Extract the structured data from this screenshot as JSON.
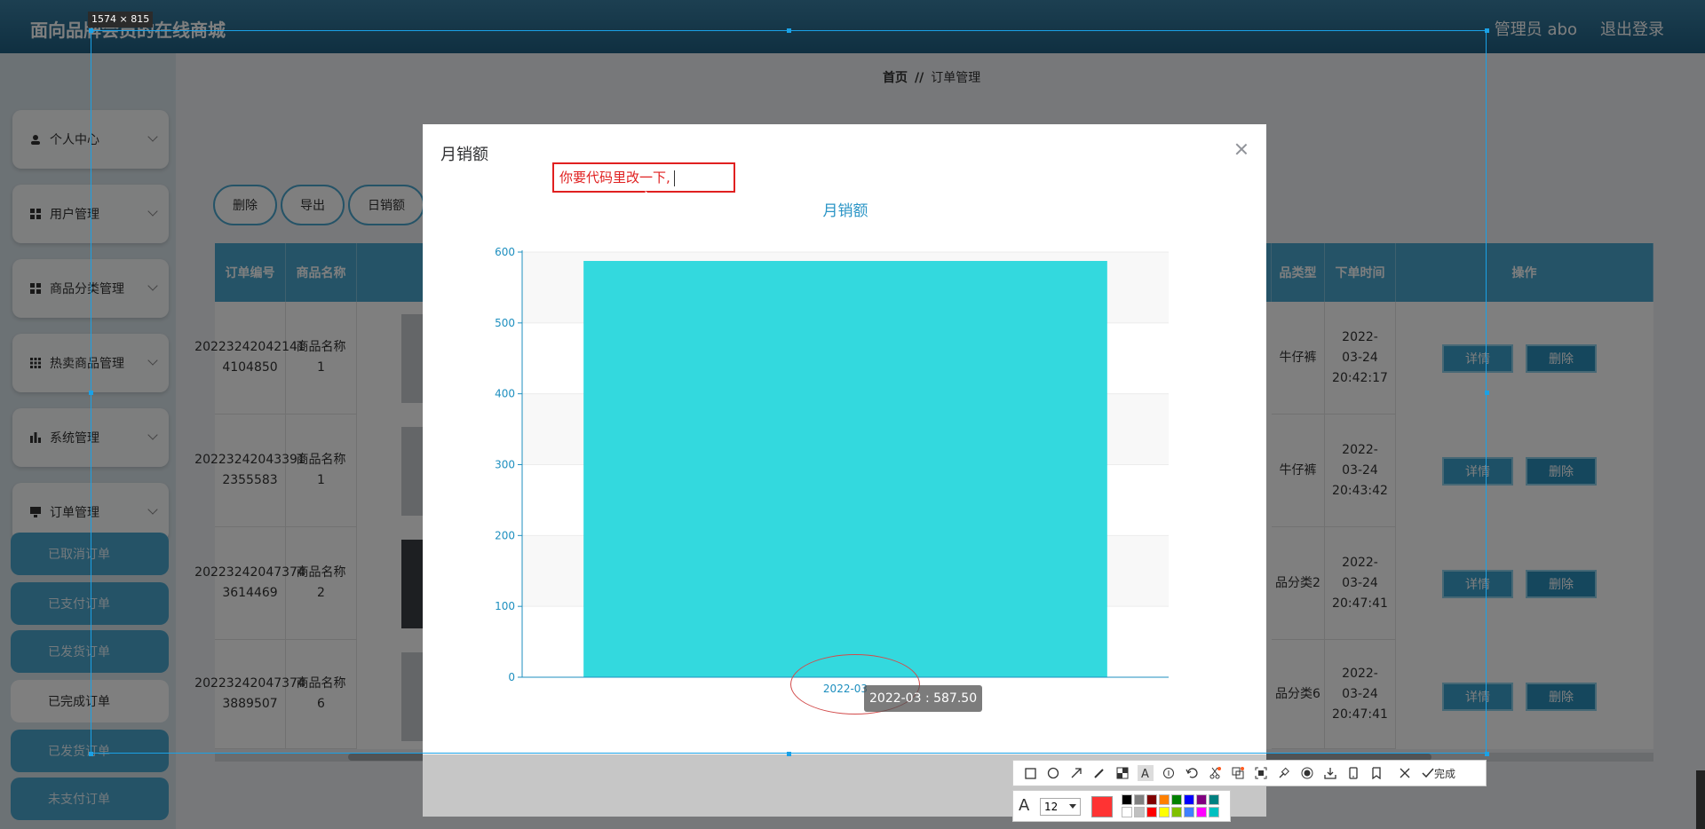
{
  "app": {
    "title": "面向品牌会员的在线商城",
    "user": "管理员 abo",
    "logout": "退出登录"
  },
  "sidebar": {
    "menus": [
      {
        "label": "个人中心",
        "icon": "person-icon"
      },
      {
        "label": "用户管理",
        "icon": "grid-icon"
      },
      {
        "label": "商品分类管理",
        "icon": "grid-icon"
      },
      {
        "label": "热卖商品管理",
        "icon": "grid-icon"
      },
      {
        "label": "系统管理",
        "icon": "chart-icon"
      },
      {
        "label": "订单管理",
        "icon": "monitor-icon"
      }
    ],
    "submenus": [
      {
        "label": "已取消订单",
        "active": false
      },
      {
        "label": "已支付订单",
        "active": false
      },
      {
        "label": "已发货订单",
        "active": false
      },
      {
        "label": "已完成订单",
        "active": true
      },
      {
        "label": "已发货订单",
        "active": false
      },
      {
        "label": "未支付订单",
        "active": false
      }
    ]
  },
  "breadcrumb": {
    "home": "首页",
    "sep": "//",
    "current": "订单管理"
  },
  "actions": {
    "delete": "删除",
    "export": "导出",
    "daily": "日销额"
  },
  "table": {
    "headers": {
      "order_no": "订单编号",
      "product": "商品名称",
      "type": "品类型",
      "time": "下单时间",
      "ops": "操作"
    },
    "rows": [
      {
        "order_no": "20223242042141 4104850",
        "product": "商品名称1",
        "type": "牛仔裤",
        "time": "2022-03-24 20:42:17"
      },
      {
        "order_no": "20223242043391 2355583",
        "product": "商品名称1",
        "type": "牛仔裤",
        "time": "2022-03-24 20:43:42"
      },
      {
        "order_no": "20223242047374 3614469",
        "product": "商品名称2",
        "type": "品分类2",
        "time": "2022-03-24 20:47:41"
      },
      {
        "order_no": "20223242047374 3889507",
        "product": "商品名称6",
        "type": "品分类6",
        "time": "2022-03-24 20:47:41"
      }
    ],
    "detail_label": "详情",
    "delete_label": "删除"
  },
  "modal": {
    "title": "月销额"
  },
  "chart_data": {
    "type": "bar",
    "title": "月销额",
    "categories": [
      "2022-03"
    ],
    "values": [
      587.5
    ],
    "ylim": [
      0,
      600
    ],
    "yticks": [
      0,
      100,
      200,
      300,
      400,
      500,
      600
    ],
    "grid": true,
    "bar_color": "#33d9de",
    "axis_color": "#1e8fbf",
    "tooltip": "2022-03 : 587.50"
  },
  "overlay": {
    "size_tag": "1574 × 815",
    "annotation": "你要代码里改一下,",
    "font_size": "12",
    "done_label": "完成",
    "current_color": "#ff3333",
    "swatches": [
      "#000000",
      "#808080",
      "#800000",
      "#ff8000",
      "#008000",
      "#0000ff",
      "#800080",
      "#008080",
      "#ffffff",
      "#c0c0c0",
      "#ff0000",
      "#ffff00",
      "#80c000",
      "#4080ff",
      "#ff00ff",
      "#00c0c0"
    ]
  }
}
